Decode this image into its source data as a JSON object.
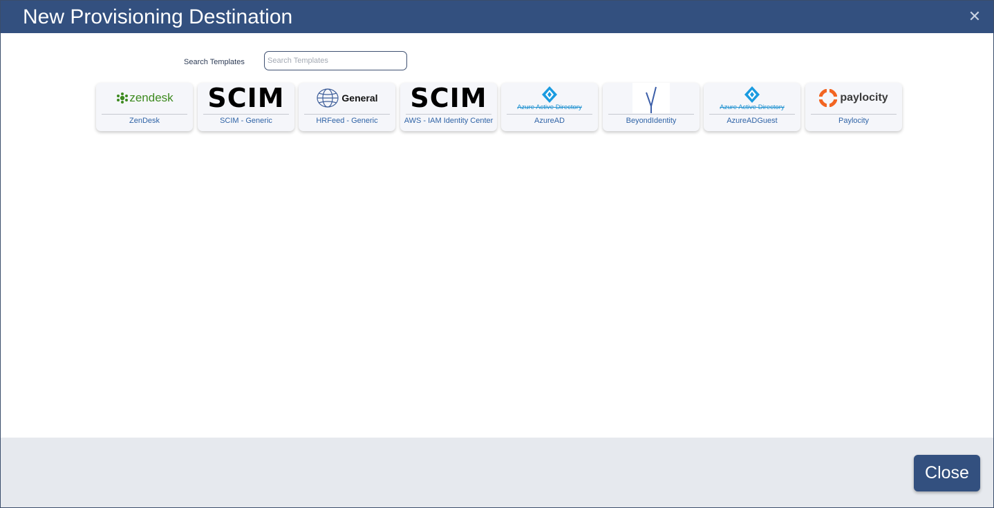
{
  "dialog": {
    "title": "New Provisioning Destination",
    "close_icon": "close-icon"
  },
  "search": {
    "label": "Search Templates",
    "placeholder": "Search Templates",
    "value": ""
  },
  "templates": [
    {
      "name": "ZenDesk",
      "logo_text": "zendesk",
      "icon": "zendesk-logo-icon"
    },
    {
      "name": "SCIM - Generic",
      "logo_text": "SCIM",
      "icon": "scim-logo-icon"
    },
    {
      "name": "HRFeed - Generic",
      "logo_text": "General",
      "icon": "globe-icon"
    },
    {
      "name": "AWS - IAM Identity Center",
      "logo_text": "SCIM",
      "icon": "scim-logo-icon"
    },
    {
      "name": "AzureAD",
      "logo_text": "Azure Active Directory",
      "icon": "azure-ad-diamond-icon"
    },
    {
      "name": "BeyondIdentity",
      "logo_text": "",
      "icon": "beyond-identity-check-icon"
    },
    {
      "name": "AzureADGuest",
      "logo_text": "Azure Active Directory",
      "icon": "azure-ad-diamond-icon"
    },
    {
      "name": "Paylocity",
      "logo_text": "paylocity",
      "icon": "paylocity-logo-icon"
    }
  ],
  "footer": {
    "close_label": "Close"
  },
  "colors": {
    "header": "#33507f",
    "footer": "#e6e9ee",
    "link": "#2f63a6",
    "azure": "#1a8fcf",
    "zendesk": "#3d8a1f",
    "paylocity": "#f26522"
  }
}
